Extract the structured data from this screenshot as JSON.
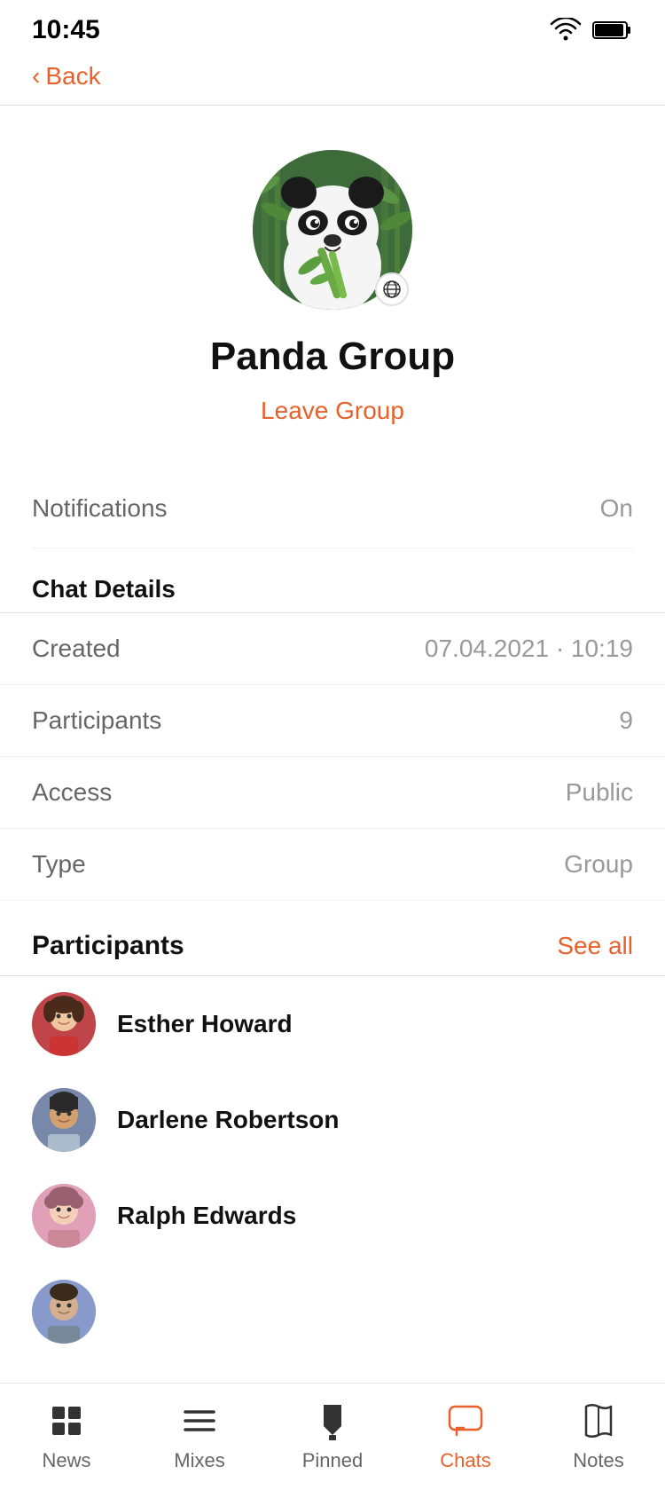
{
  "statusBar": {
    "time": "10:45"
  },
  "header": {
    "backLabel": "Back"
  },
  "profile": {
    "name": "Panda Group",
    "leaveGroup": "Leave Group"
  },
  "notifications": {
    "label": "Notifications",
    "value": "On"
  },
  "chatDetails": {
    "sectionHeader": "Chat Details",
    "rows": [
      {
        "label": "Created",
        "value": "07.04.2021 · 10:19"
      },
      {
        "label": "Participants",
        "value": "9"
      },
      {
        "label": "Access",
        "value": "Public"
      },
      {
        "label": "Type",
        "value": "Group"
      }
    ]
  },
  "participants": {
    "sectionHeader": "Participants",
    "seeAll": "See all",
    "items": [
      {
        "name": "Esther Howard",
        "avatarType": "esther",
        "emoji": "👤"
      },
      {
        "name": "Darlene Robertson",
        "avatarType": "darlene",
        "emoji": "👤"
      },
      {
        "name": "Ralph Edwards",
        "avatarType": "ralph",
        "emoji": "👤"
      }
    ]
  },
  "bottomNav": {
    "items": [
      {
        "id": "news",
        "label": "News",
        "active": false
      },
      {
        "id": "mixes",
        "label": "Mixes",
        "active": false
      },
      {
        "id": "pinned",
        "label": "Pinned",
        "active": false
      },
      {
        "id": "chats",
        "label": "Chats",
        "active": true
      },
      {
        "id": "notes",
        "label": "Notes",
        "active": false
      }
    ]
  }
}
